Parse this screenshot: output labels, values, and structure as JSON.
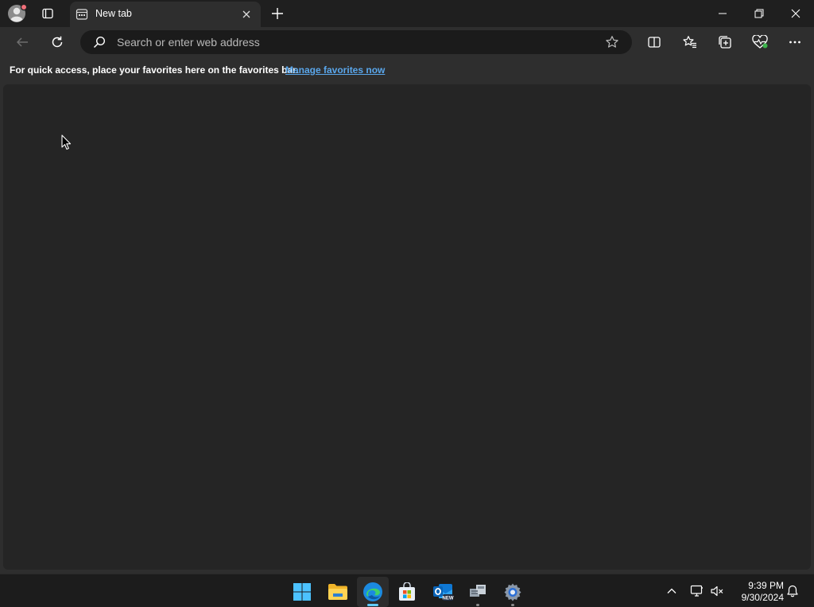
{
  "browser": {
    "tab": {
      "title": "New tab"
    },
    "address_bar": {
      "placeholder": "Search or enter web address",
      "value": ""
    },
    "favorites_bar": {
      "message": "For quick access, place your favorites here on the favorites bar.",
      "link": "Manage favorites now"
    }
  },
  "taskbar": {
    "apps": [
      {
        "name": "Start",
        "icon": "windows-start-icon"
      },
      {
        "name": "File Explorer",
        "icon": "folder-icon"
      },
      {
        "name": "Microsoft Edge",
        "icon": "edge-icon",
        "active": true
      },
      {
        "name": "Microsoft Store",
        "icon": "store-icon"
      },
      {
        "name": "Outlook (new)",
        "icon": "outlook-icon",
        "badge": "NEW"
      },
      {
        "name": "Network app",
        "icon": "network-app-icon"
      },
      {
        "name": "Settings",
        "icon": "gear-icon"
      }
    ],
    "clock": {
      "time": "9:39 PM",
      "date": "9/30/2024"
    }
  },
  "colors": {
    "accent": "#60cdff",
    "link": "#5aa7ec",
    "chrome_bg": "#2e2e2e",
    "titlebar_bg": "#1f1f1f",
    "page_bg": "#252525",
    "taskbar_bg": "#1c1c1c"
  }
}
